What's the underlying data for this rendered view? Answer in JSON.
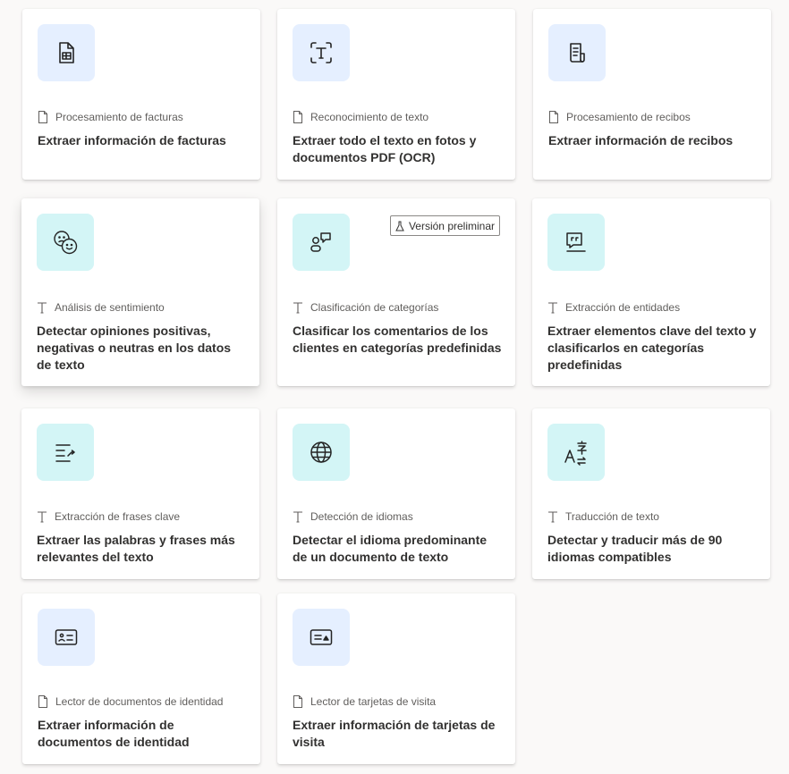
{
  "cards": [
    {
      "category": "Procesamiento de facturas",
      "title": "Extraer información de facturas",
      "icon": "invoice-icon",
      "kind": "document"
    },
    {
      "category": "Reconocimiento de texto",
      "title": "Extraer todo el texto en fotos y documentos PDF (OCR)",
      "icon": "text-recognition-icon",
      "kind": "document"
    },
    {
      "category": "Procesamiento de recibos",
      "title": "Extraer información de recibos",
      "icon": "receipt-icon",
      "kind": "document"
    },
    {
      "category": "Análisis de sentimiento",
      "title": "Detectar opiniones positivas, negativas o neutras en los datos de texto",
      "icon": "sentiment-icon",
      "kind": "text"
    },
    {
      "category": "Clasificación de categorías",
      "title": "Clasificar los comentarios de los clientes en categorías predefinidas",
      "icon": "category-classification-icon",
      "kind": "text",
      "badge": "Versión preliminar"
    },
    {
      "category": "Extracción de entidades",
      "title": "Extraer elementos clave del texto y clasificarlos en categorías predefinidas",
      "icon": "entity-extraction-icon",
      "kind": "text"
    },
    {
      "category": "Extracción de frases clave",
      "title": "Extraer las palabras y frases más relevantes del texto",
      "icon": "key-phrase-icon",
      "kind": "text"
    },
    {
      "category": "Detección de idiomas",
      "title": "Detectar el idioma predominante de un documento de texto",
      "icon": "globe-icon",
      "kind": "text"
    },
    {
      "category": "Traducción de texto",
      "title": "Detectar y traducir más de 90 idiomas compatibles",
      "icon": "translate-icon",
      "kind": "text"
    },
    {
      "category": "Lector de documentos de identidad",
      "title": "Extraer información de documentos de identidad",
      "icon": "id-card-icon",
      "kind": "document"
    },
    {
      "category": "Lector de tarjetas de visita",
      "title": "Extraer información de tarjetas de visita",
      "icon": "business-card-icon",
      "kind": "document"
    }
  ],
  "colors": {
    "tile_blue": "#e5efff",
    "tile_teal": "#d3f5f6",
    "background": "#faf9f8"
  }
}
